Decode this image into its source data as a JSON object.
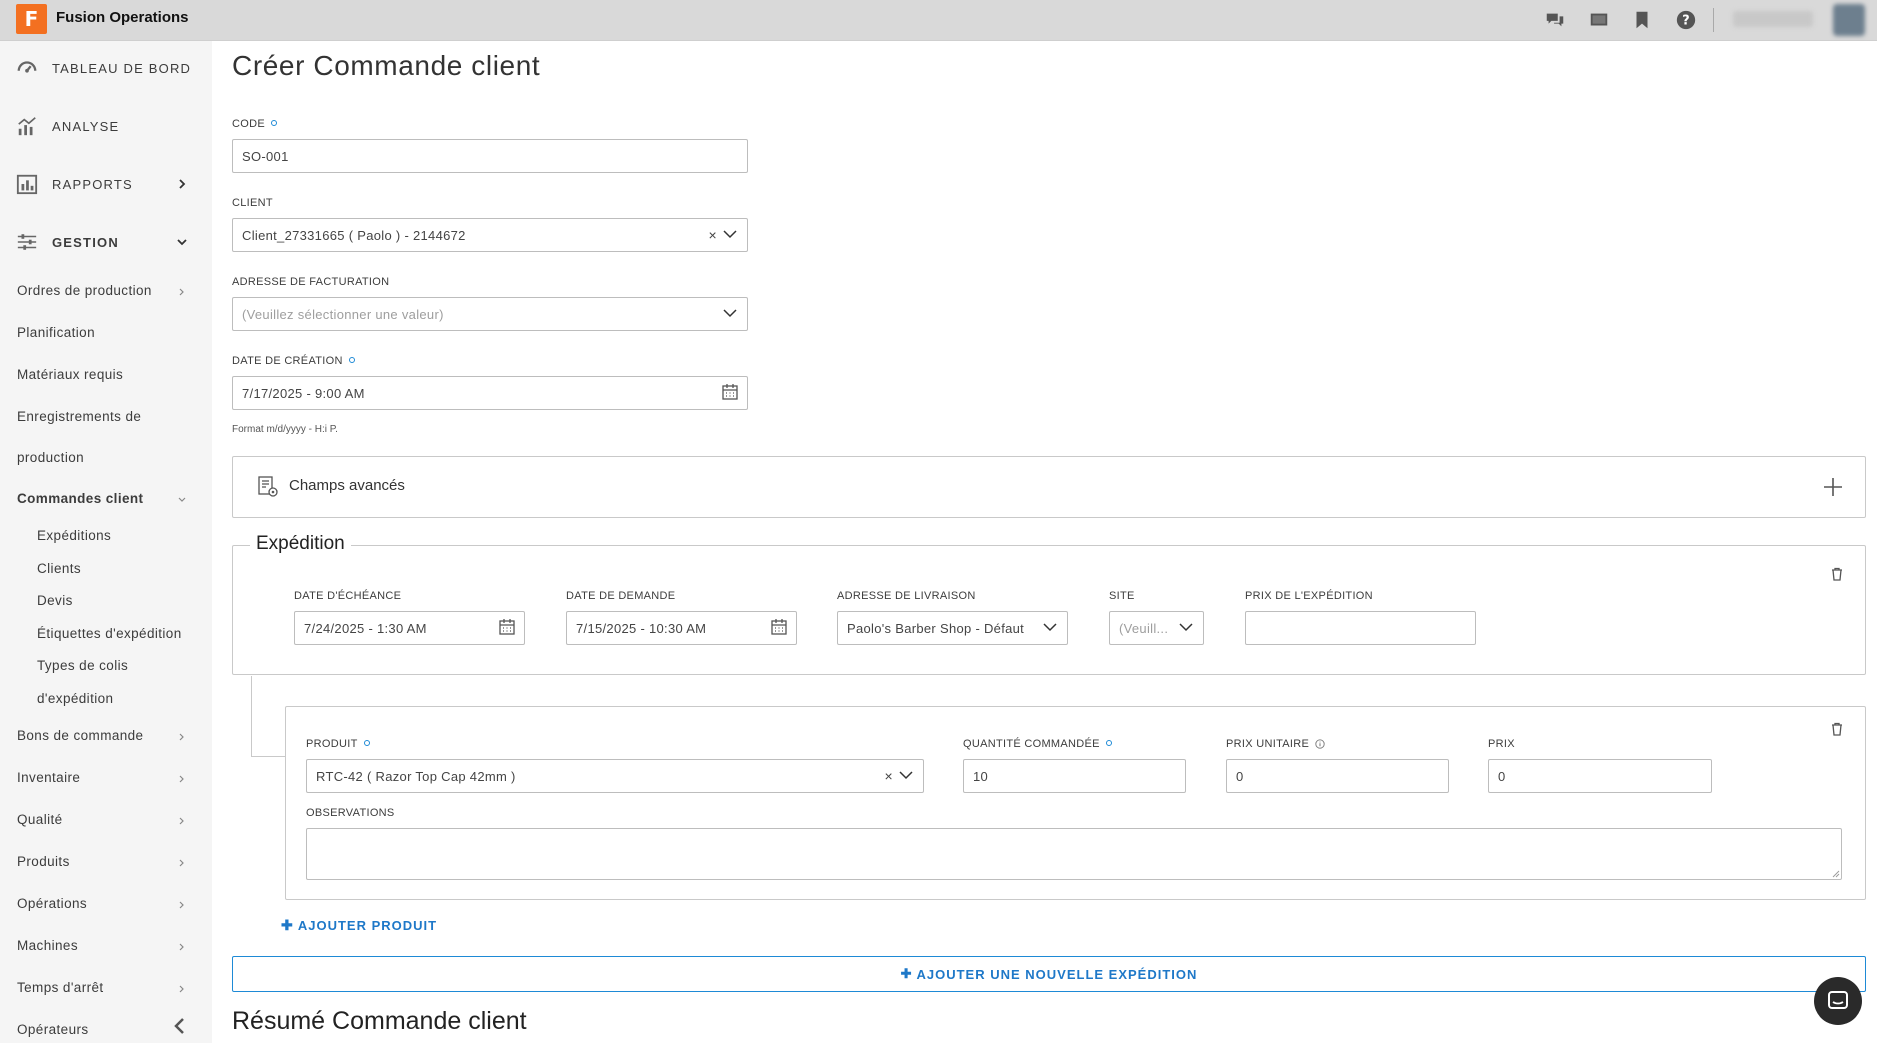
{
  "app": {
    "title": "Fusion Operations",
    "logo_letter": "F"
  },
  "topbar": {
    "icons": [
      "chat-icon",
      "screen-icon",
      "bookmark-icon",
      "help-icon"
    ],
    "brand_color": "#f37021"
  },
  "sidebar": {
    "main": [
      {
        "label": "TABLEAU DE BORD",
        "icon": "dashboard-icon"
      },
      {
        "label": "ANALYSE",
        "icon": "analytics-icon"
      },
      {
        "label": "RAPPORTS",
        "icon": "reports-icon"
      },
      {
        "label": "GESTION",
        "icon": "settings-sliders-icon"
      }
    ],
    "gestion_items": [
      {
        "label": "Ordres de production"
      },
      {
        "label": "Planification"
      },
      {
        "label": "Matériaux requis"
      },
      {
        "label": "Enregistrements de"
      },
      {
        "label": "production"
      },
      {
        "label": "Commandes client"
      }
    ],
    "commandes_children": [
      "Expéditions",
      "Clients",
      "Devis",
      "Étiquettes d'expédition",
      "Types de colis",
      "d'expédition"
    ],
    "more_items": [
      "Bons de commande",
      "Inventaire",
      "Qualité",
      "Produits",
      "Opérations",
      "Machines",
      "Temps d'arrêt",
      "Opérateurs"
    ]
  },
  "form": {
    "title": "Créer Commande client",
    "code": {
      "label": "CODE",
      "value": "SO-001"
    },
    "client": {
      "label": "CLIENT",
      "value": "Client_27331665 ( Paolo ) - 2144672"
    },
    "billing": {
      "label": "ADRESSE DE FACTURATION",
      "placeholder": "(Veuillez sélectionner une valeur)"
    },
    "created": {
      "label": "DATE DE CRÉATION",
      "value": "7/17/2025 - 9:00 AM",
      "hint": "Format m/d/yyyy - H:i P."
    },
    "advanced": {
      "label": "Champs avancés"
    }
  },
  "shipment": {
    "legend": "Expédition",
    "due_date": {
      "label": "DATE D'ÉCHÉANCE",
      "value": "7/24/2025 - 1:30 AM"
    },
    "request_date": {
      "label": "DATE DE DEMANDE",
      "value": "7/15/2025 - 10:30 AM"
    },
    "delivery_address": {
      "label": "ADRESSE DE LIVRAISON",
      "value": "Paolo's Barber Shop - Défaut"
    },
    "site": {
      "label": "SITE",
      "placeholder": "(Veuill..."
    },
    "shipping_price": {
      "label": "PRIX DE L'EXPÉDITION",
      "value": ""
    }
  },
  "product_line": {
    "product": {
      "label": "PRODUIT",
      "value": "RTC-42 ( Razor Top Cap 42mm )"
    },
    "quantity": {
      "label": "QUANTITÉ COMMANDÉE",
      "value": "10"
    },
    "unit_price": {
      "label": "PRIX UNITAIRE",
      "value": "0"
    },
    "price": {
      "label": "PRIX",
      "value": "0"
    },
    "notes": {
      "label": "OBSERVATIONS",
      "value": ""
    }
  },
  "actions": {
    "add_product": "AJOUTER PRODUIT",
    "add_shipment": "AJOUTER UNE NOUVELLE EXPÉDITION"
  },
  "summary": {
    "title": "Résumé Commande client"
  }
}
